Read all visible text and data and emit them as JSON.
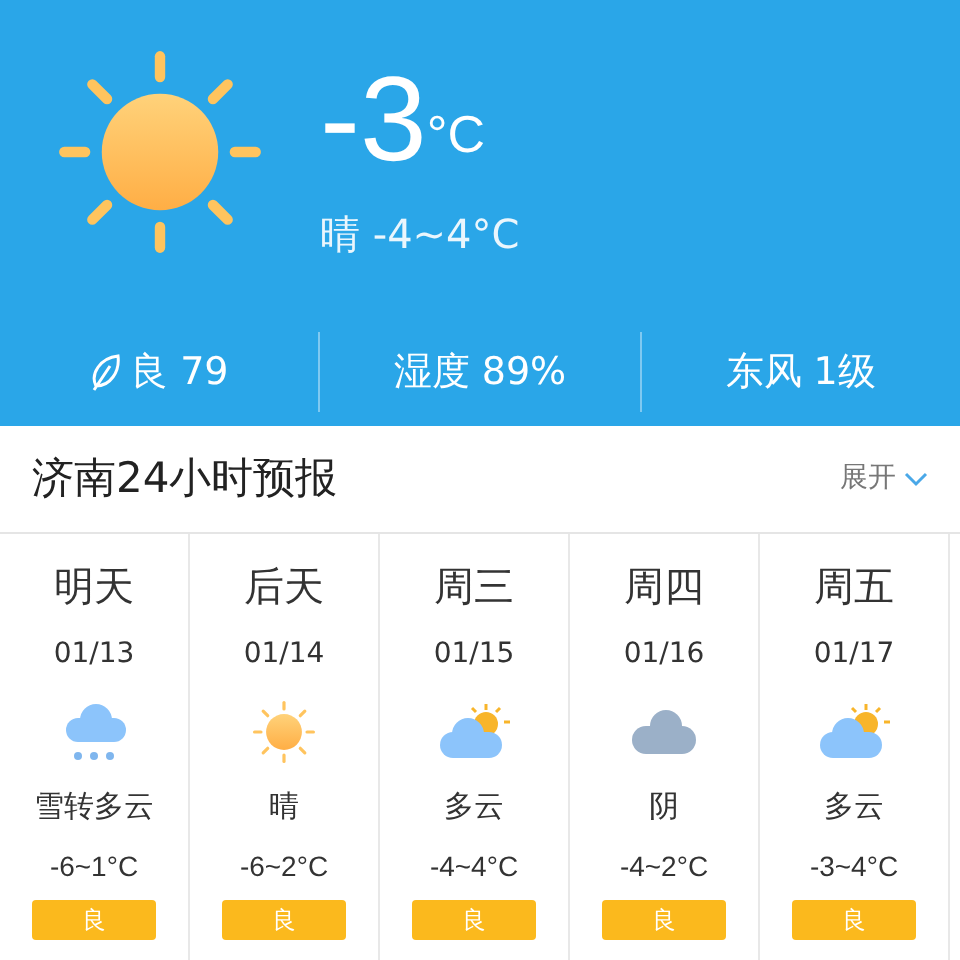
{
  "current": {
    "temperature": "-3",
    "unit": "°C",
    "summary": "晴 -4~4°C",
    "kind": "sunny"
  },
  "stats": [
    {
      "kind": "air",
      "text": "良 79"
    },
    {
      "kind": "plain",
      "text": "湿度 89%"
    },
    {
      "kind": "plain",
      "text": "东风 1级"
    }
  ],
  "forecast_header": {
    "title": "济南24小时预报",
    "toggle": "展开"
  },
  "days": [
    {
      "day": "明天",
      "date": "01/13",
      "kind": "snow",
      "description": "雪转多云",
      "range": "-6~1°C",
      "air": "良"
    },
    {
      "day": "后天",
      "date": "01/14",
      "kind": "sunny",
      "description": "晴",
      "range": "-6~2°C",
      "air": "良"
    },
    {
      "day": "周三",
      "date": "01/15",
      "kind": "partly_cloudy",
      "description": "多云",
      "range": "-4~4°C",
      "air": "良"
    },
    {
      "day": "周四",
      "date": "01/16",
      "kind": "overcast",
      "description": "阴",
      "range": "-4~2°C",
      "air": "良"
    },
    {
      "day": "周五",
      "date": "01/17",
      "kind": "partly_cloudy",
      "description": "多云",
      "range": "-3~4°C",
      "air": "良"
    }
  ]
}
